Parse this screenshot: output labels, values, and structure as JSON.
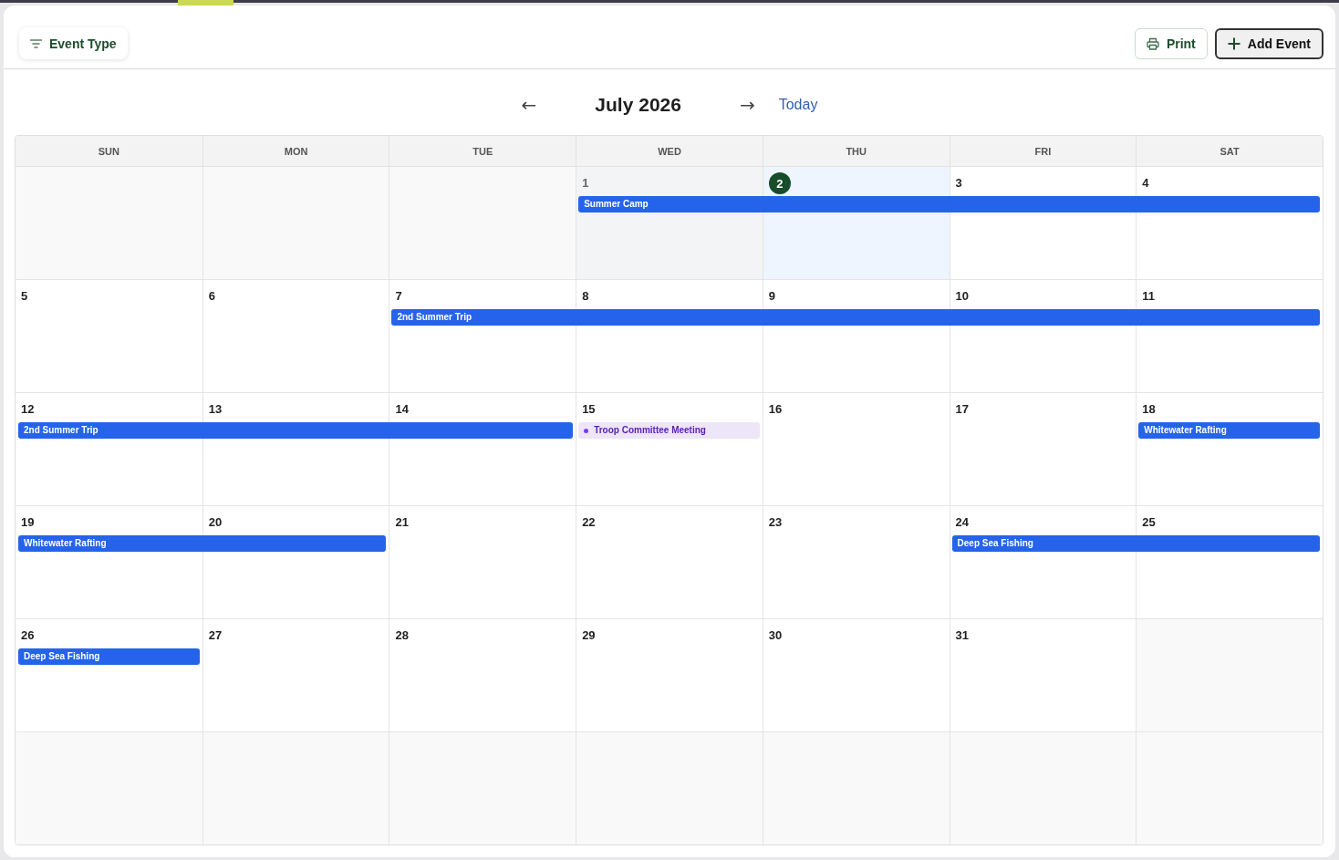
{
  "toolbar": {
    "filter_button": {
      "label": "Event Type"
    },
    "print_button": {
      "label": "Print"
    },
    "add_event_button": {
      "label": "Add Event"
    }
  },
  "month_nav": {
    "previous": "←",
    "title": "July 2026",
    "next": "→",
    "today_link": "Today"
  },
  "calendar": {
    "weekdays": [
      "SUN",
      "MON",
      "TUE",
      "WED",
      "THU",
      "FRI",
      "SAT"
    ],
    "weeks": [
      {
        "days": [
          {
            "kind": "empty"
          },
          {
            "kind": "empty"
          },
          {
            "kind": "empty"
          },
          {
            "day": "1",
            "kind": "past",
            "event": {
              "kind": "bar",
              "title": "Summer Camp",
              "color": "#2563eb"
            }
          },
          {
            "day": "2",
            "kind": "today",
            "event": {
              "kind": "continued"
            }
          },
          {
            "day": "3",
            "kind": "normal",
            "event": {
              "kind": "continued"
            }
          },
          {
            "day": "4",
            "kind": "normal",
            "event": {
              "kind": "continued"
            }
          }
        ]
      },
      {
        "days": [
          {
            "day": "5",
            "kind": "normal"
          },
          {
            "day": "6",
            "kind": "normal"
          },
          {
            "day": "7",
            "kind": "normal",
            "event": {
              "kind": "bar",
              "title": "2nd Summer Trip",
              "color": "#2563eb"
            }
          },
          {
            "day": "8",
            "kind": "normal",
            "event": {
              "kind": "continued"
            }
          },
          {
            "day": "9",
            "kind": "normal",
            "event": {
              "kind": "continued"
            }
          },
          {
            "day": "10",
            "kind": "normal",
            "event": {
              "kind": "continued"
            }
          },
          {
            "day": "11",
            "kind": "normal",
            "event": {
              "kind": "continued"
            }
          }
        ]
      },
      {
        "days": [
          {
            "day": "12",
            "kind": "normal",
            "event": {
              "kind": "bar",
              "title": "2nd Summer Trip",
              "color": "#2563eb"
            }
          },
          {
            "day": "13",
            "kind": "normal",
            "event": {
              "kind": "continued"
            }
          },
          {
            "day": "14",
            "kind": "normal",
            "event": {
              "kind": "continued"
            }
          },
          {
            "day": "15",
            "kind": "normal",
            "event": {
              "kind": "dot",
              "title": "Troop Committee Meeting",
              "color": "#7c3aed"
            }
          },
          {
            "day": "16",
            "kind": "normal"
          },
          {
            "day": "17",
            "kind": "normal"
          },
          {
            "day": "18",
            "kind": "normal",
            "event": {
              "kind": "bar",
              "title": "Whitewater Rafting",
              "color": "#2563eb"
            }
          }
        ]
      },
      {
        "days": [
          {
            "day": "19",
            "kind": "normal",
            "event": {
              "kind": "bar",
              "title": "Whitewater Rafting",
              "color": "#2563eb"
            }
          },
          {
            "day": "20",
            "kind": "normal",
            "event": {
              "kind": "continued"
            }
          },
          {
            "day": "21",
            "kind": "normal"
          },
          {
            "day": "22",
            "kind": "normal"
          },
          {
            "day": "23",
            "kind": "normal"
          },
          {
            "day": "24",
            "kind": "normal",
            "event": {
              "kind": "bar",
              "title": "Deep Sea Fishing",
              "color": "#2563eb"
            }
          },
          {
            "day": "25",
            "kind": "normal",
            "event": {
              "kind": "continued"
            }
          }
        ]
      },
      {
        "days": [
          {
            "day": "26",
            "kind": "normal",
            "event": {
              "kind": "bar",
              "title": "Deep Sea Fishing",
              "color": "#2563eb"
            }
          },
          {
            "day": "27",
            "kind": "normal"
          },
          {
            "day": "28",
            "kind": "normal"
          },
          {
            "day": "29",
            "kind": "normal"
          },
          {
            "day": "30",
            "kind": "normal"
          },
          {
            "day": "31",
            "kind": "normal"
          },
          {
            "kind": "empty"
          }
        ]
      },
      {
        "days": [
          {
            "kind": "empty"
          },
          {
            "kind": "empty"
          },
          {
            "kind": "empty"
          },
          {
            "kind": "empty"
          },
          {
            "kind": "empty"
          },
          {
            "kind": "empty"
          },
          {
            "kind": "empty"
          }
        ]
      }
    ]
  }
}
